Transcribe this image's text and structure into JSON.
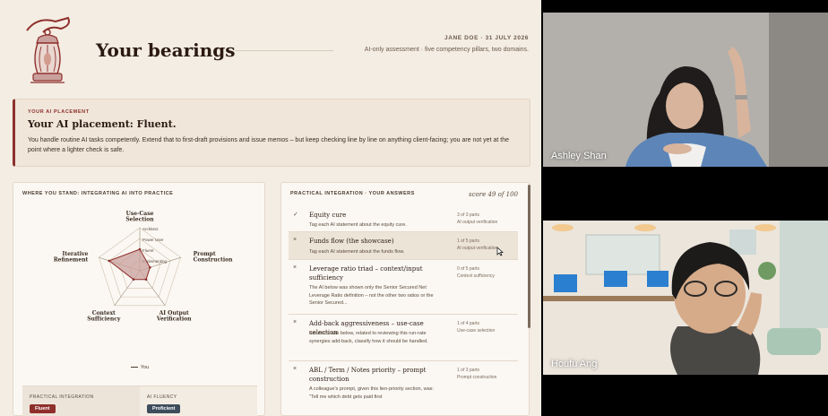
{
  "header": {
    "title": "Your bearings",
    "byline": "JANE DOE  ·  31 JULY 2026",
    "subline": "AI-only assessment · five competency pillars, two domains."
  },
  "placement": {
    "eyebrow": "YOUR AI PLACEMENT",
    "heading": "Your AI placement: Fluent.",
    "body": "You handle routine AI tasks competently. Extend that to first-draft provisions and issue memos – but keep checking line by line on anything client-facing; you are not yet at the point where a lighter check is safe."
  },
  "radar_card": {
    "title": "WHERE YOU STAND: INTEGRATING AI INTO PRACTICE",
    "axes": [
      {
        "label1": "Use-Case",
        "label2": "Selection"
      },
      {
        "label1": "Prompt",
        "label2": "Construction"
      },
      {
        "label1": "AI Output",
        "label2": "Verification"
      },
      {
        "label1": "Context",
        "label2": "Sufficiency"
      },
      {
        "label1": "Iterative",
        "label2": "Refinement"
      }
    ],
    "rings": [
      "Architect",
      "Power User",
      "Fluent",
      "Implementing"
    ],
    "scores": [
      2,
      1,
      1,
      1,
      3
    ],
    "legend": "You",
    "practical_label": "PRACTICAL INTEGRATION",
    "practical_level": "Fluent",
    "fluency_label": "AI FLUENCY",
    "fluency_level": "Proficient",
    "colors": {
      "accent": "#8e2f2c",
      "fill": "#c9a09c",
      "slate": "#3e4d5c"
    }
  },
  "answers": {
    "title": "PRACTICAL INTEGRATION · YOUR ANSWERS",
    "score": "score 49 of 100",
    "items": [
      {
        "mark": "✓",
        "name": "Equity cure",
        "desc": "Tag each AI statement about the equity cure.",
        "meta1": "3 of 3 parts",
        "meta2": "AI output verification"
      },
      {
        "mark": "×",
        "name": "Funds flow (the showcase)",
        "desc": "Tag each AI statement about the funds flow.",
        "meta1": "1 of 5 parts",
        "meta2": "AI output verification"
      },
      {
        "mark": "×",
        "name": "Leverage ratio triad – context/input sufficiency",
        "desc": "The AI below was shown only the Senior Secured Net Leverage Ratio definition – not the other two ratios or the Senior Secured...",
        "meta1": "0 of 5 parts",
        "meta2": "Context sufficiency"
      },
      {
        "mark": "×",
        "name": "Add-back aggressiveness – use-case selection",
        "desc": "For each task below, related to reviewing this run-rate synergies add-back, classify how it should be handled.",
        "meta1": "1 of 4 parts",
        "meta2": "Use-case selection"
      },
      {
        "mark": "×",
        "name": "ABL / Term / Notes priority – prompt construction",
        "desc": "A colleague's prompt, given this lien-priority section, was: \"Tell me which debt gets paid first",
        "meta1": "1 of 3 parts",
        "meta2": "Prompt construction"
      }
    ]
  },
  "participants": [
    {
      "name": "Ashley Shan"
    },
    {
      "name": "Houfu Ang"
    }
  ]
}
